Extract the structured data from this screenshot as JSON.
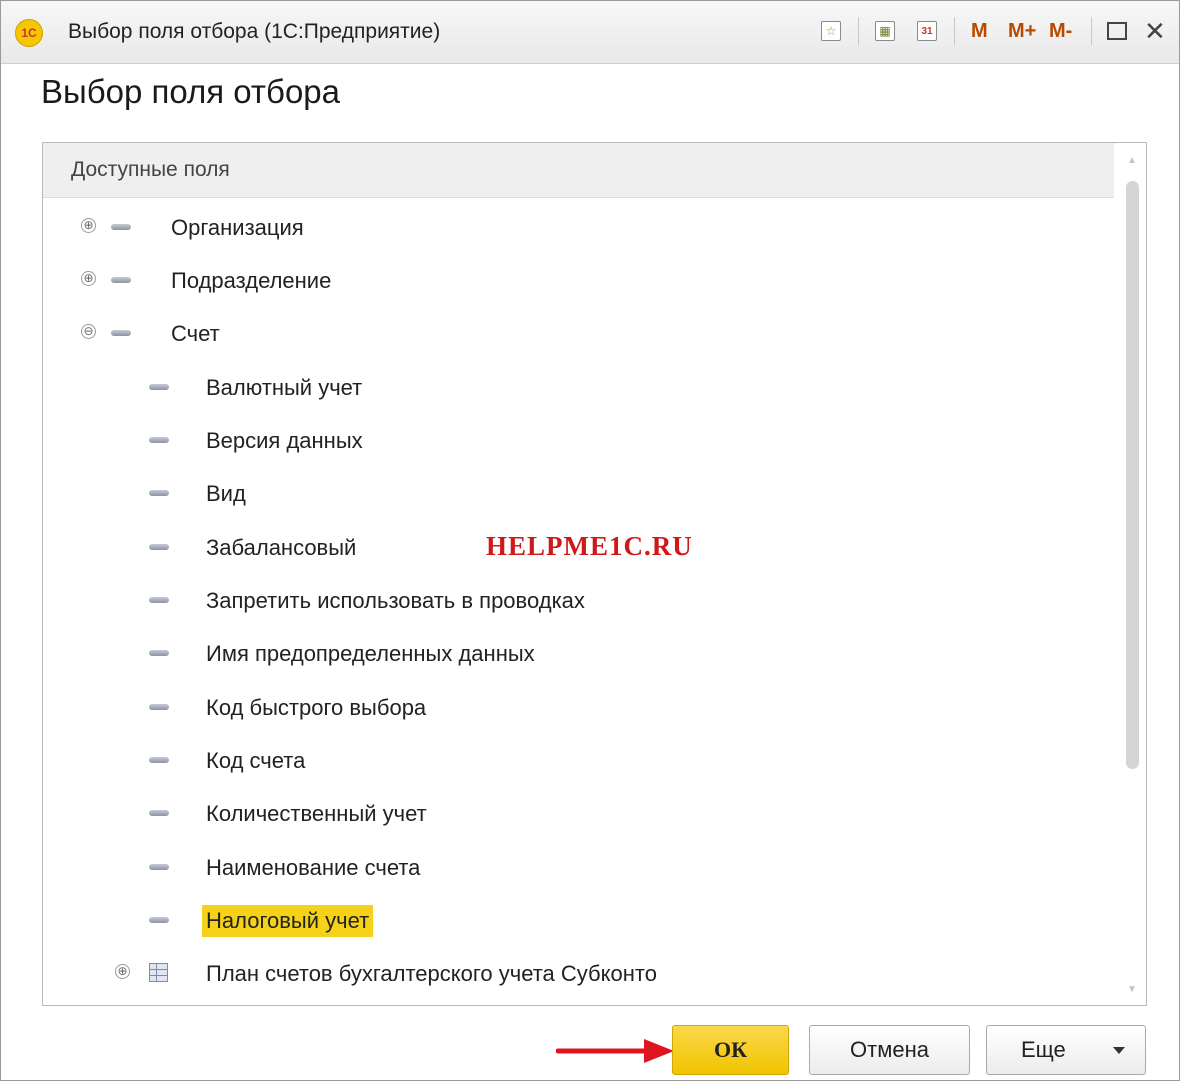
{
  "window": {
    "title": "Выбор поля отбора (1С:Предприятие)",
    "logo": "1С",
    "toolbar": {
      "favorite_icon": "star-icon",
      "calculator_icon": "calculator-icon",
      "calendar_icon": "calendar-icon",
      "calendar_day": "31",
      "m_label": "M",
      "m_plus_label": "M+",
      "m_minus_label": "M-"
    }
  },
  "heading": "Выбор поля отбора",
  "tree": {
    "header": "Доступные поля",
    "items": [
      {
        "label": "Организация",
        "expander": "⊕",
        "level": 0
      },
      {
        "label": "Подразделение",
        "expander": "⊕",
        "level": 0
      },
      {
        "label": "Счет",
        "expander": "⊖",
        "level": 0
      },
      {
        "label": "Валютный учет",
        "level": 1
      },
      {
        "label": "Версия данных",
        "level": 1
      },
      {
        "label": "Вид",
        "level": 1
      },
      {
        "label": "Забалансовый",
        "level": 1
      },
      {
        "label": "Запретить использовать в проводках",
        "level": 1
      },
      {
        "label": "Имя предопределенных данных",
        "level": 1
      },
      {
        "label": "Код быстрого выбора",
        "level": 1
      },
      {
        "label": "Код счета",
        "level": 1
      },
      {
        "label": "Количественный учет",
        "level": 1
      },
      {
        "label": "Наименование счета",
        "level": 1
      },
      {
        "label": "Налоговый учет",
        "level": 1,
        "selected": true
      },
      {
        "label": "План счетов бухгалтерского учета Субконто",
        "expander": "⊕",
        "level": 1,
        "icon": "table-icon"
      }
    ]
  },
  "watermark": "HELPME1C.RU",
  "buttons": {
    "ok": "ОК",
    "cancel": "Отмена",
    "more": "Еще"
  },
  "colors": {
    "selection": "#f5d217",
    "ok_button": "#f1c400",
    "arrow": "#e0141e",
    "watermark": "#d01818"
  }
}
